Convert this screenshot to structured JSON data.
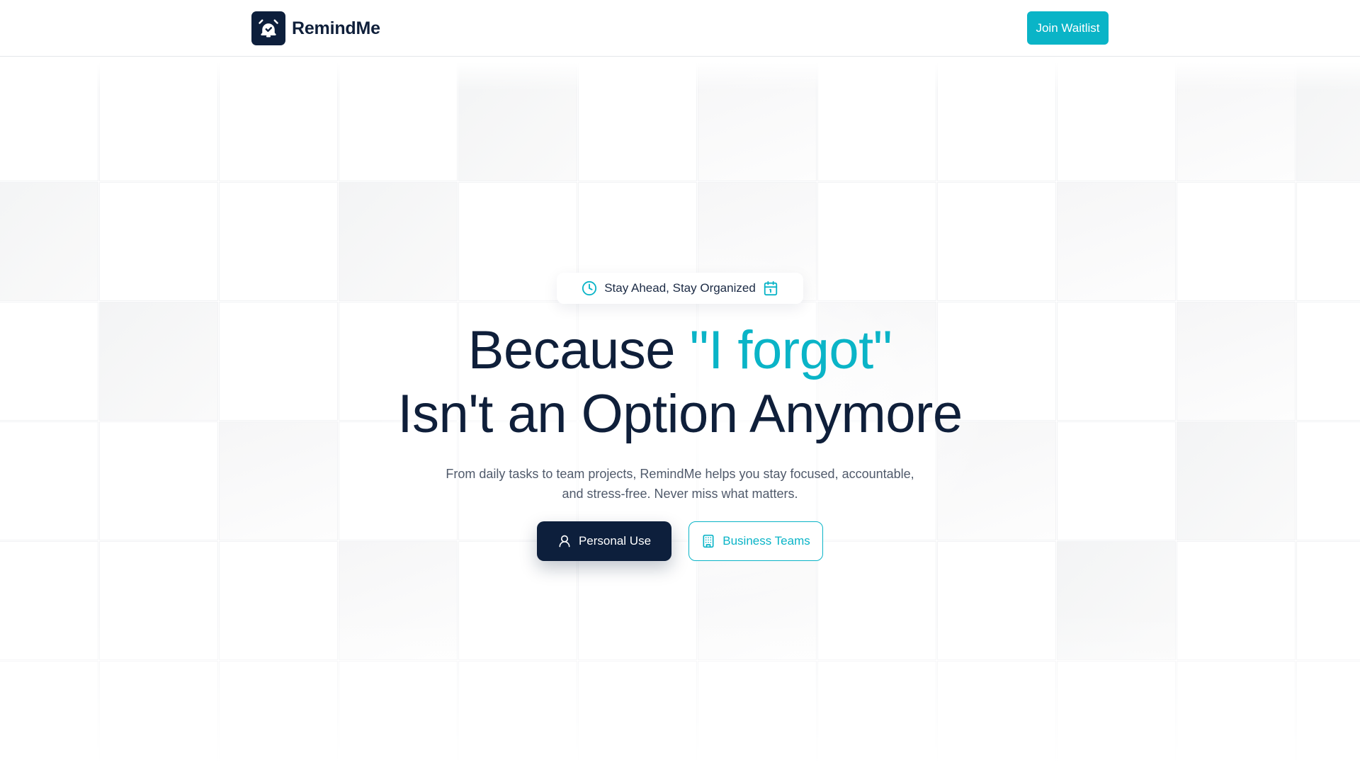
{
  "header": {
    "brand_name": "RemindMe",
    "logo_icon": "alarm-check-icon",
    "join_label": "Join Waitlist"
  },
  "hero": {
    "badge": {
      "text": "Stay Ahead, Stay Organized",
      "left_icon": "clock-icon",
      "right_icon": "calendar-icon"
    },
    "headline": {
      "prefix": "Because ",
      "accent": "\"I forgot\"",
      "line2": "Isn't an Option Anymore"
    },
    "subtext": {
      "line1": "From daily tasks to team projects, RemindMe helps you stay focused, accountable,",
      "line2": "and stress-free. Never miss what matters."
    },
    "buttons": {
      "personal_label": "Personal Use",
      "personal_icon": "user-icon",
      "business_label": "Business Teams",
      "business_icon": "building-icon"
    }
  },
  "colors": {
    "navy": "#0d1f3c",
    "accent": "#0ab4c7",
    "body_text": "#505a6b"
  }
}
